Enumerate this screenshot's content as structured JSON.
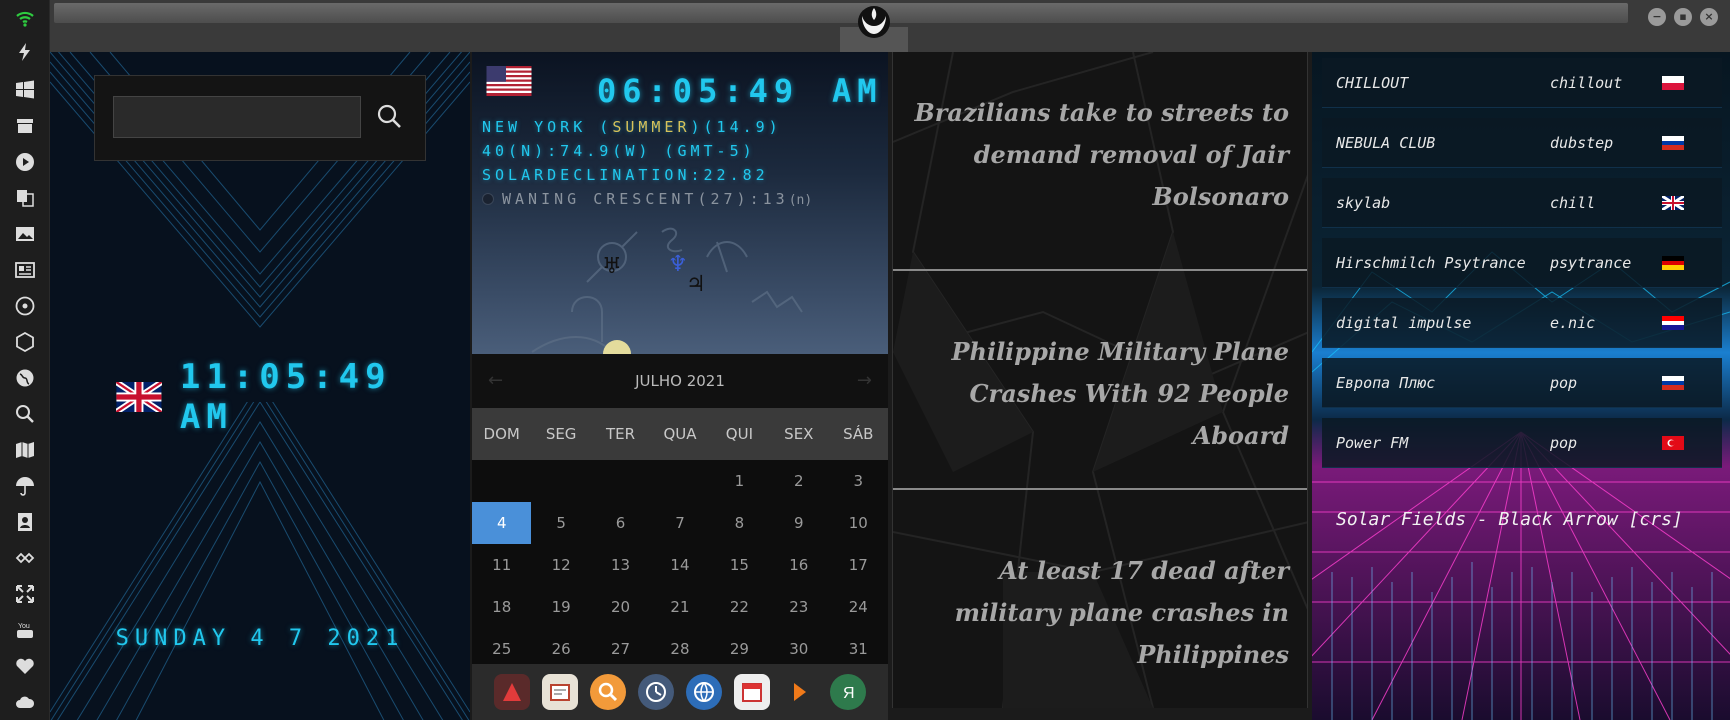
{
  "panel2": {
    "time": "06:05:49",
    "ampm": "AM",
    "loc_city": "NEW YORK (",
    "loc_season": "SUMMER",
    "loc_rest": ")(14.9)",
    "coords": "40(N):74.9(W) (GMT-5)",
    "solar": "SOLARDECLINATION:22.82",
    "moon": "WANING CRESCENT(27):13",
    "moon_suffix": "(n)",
    "planets": [
      "♅",
      "♆",
      "♃"
    ],
    "calendar": {
      "month": "JULHO 2021",
      "prev": "←",
      "next": "→",
      "dows": [
        "DOM",
        "SEG",
        "TER",
        "QUA",
        "QUI",
        "SEX",
        "SÁB"
      ],
      "weeks": [
        [
          "",
          "",
          "",
          "",
          "1",
          "2",
          "3"
        ],
        [
          "4",
          "5",
          "6",
          "7",
          "8",
          "9",
          "10"
        ],
        [
          "11",
          "12",
          "13",
          "14",
          "15",
          "16",
          "17"
        ],
        [
          "18",
          "19",
          "20",
          "21",
          "22",
          "23",
          "24"
        ],
        [
          "25",
          "26",
          "27",
          "28",
          "29",
          "30",
          "31"
        ]
      ],
      "today": "4"
    }
  },
  "panel1": {
    "search_value": "",
    "clock": "11:05:49  AM",
    "date": "SUNDAY 4 7 2021"
  },
  "news": [
    "Brazilians take to streets to demand removal of Jair Bolsonaro",
    "Philippine Military Plane Crashes With 92 People Aboard",
    "At least 17 dead after military plane crashes in Philippines"
  ],
  "radio": [
    {
      "name": "CHILLOUT",
      "genre": "chillout",
      "flag": "pl"
    },
    {
      "name": "NEBULA CLUB",
      "genre": "dubstep",
      "flag": "ru"
    },
    {
      "name": "skylab",
      "genre": "chill",
      "flag": "uk"
    },
    {
      "name": "Hirschmilch Psytrance",
      "genre": "psytrance",
      "flag": "de"
    },
    {
      "name": "digital impulse",
      "genre": "e.nic",
      "flag": "hr"
    },
    {
      "name": "Европа Плюс",
      "genre": "pop",
      "flag": "ru"
    },
    {
      "name": "Power FM",
      "genre": "pop",
      "flag": "tr"
    }
  ],
  "now_playing": "Solar Fields - Black Arrow [crs]",
  "colors": {
    "lcd": "#21c8ee",
    "accent_today": "#4a90d9"
  },
  "window_buttons": [
    "−",
    "▪",
    "×"
  ]
}
